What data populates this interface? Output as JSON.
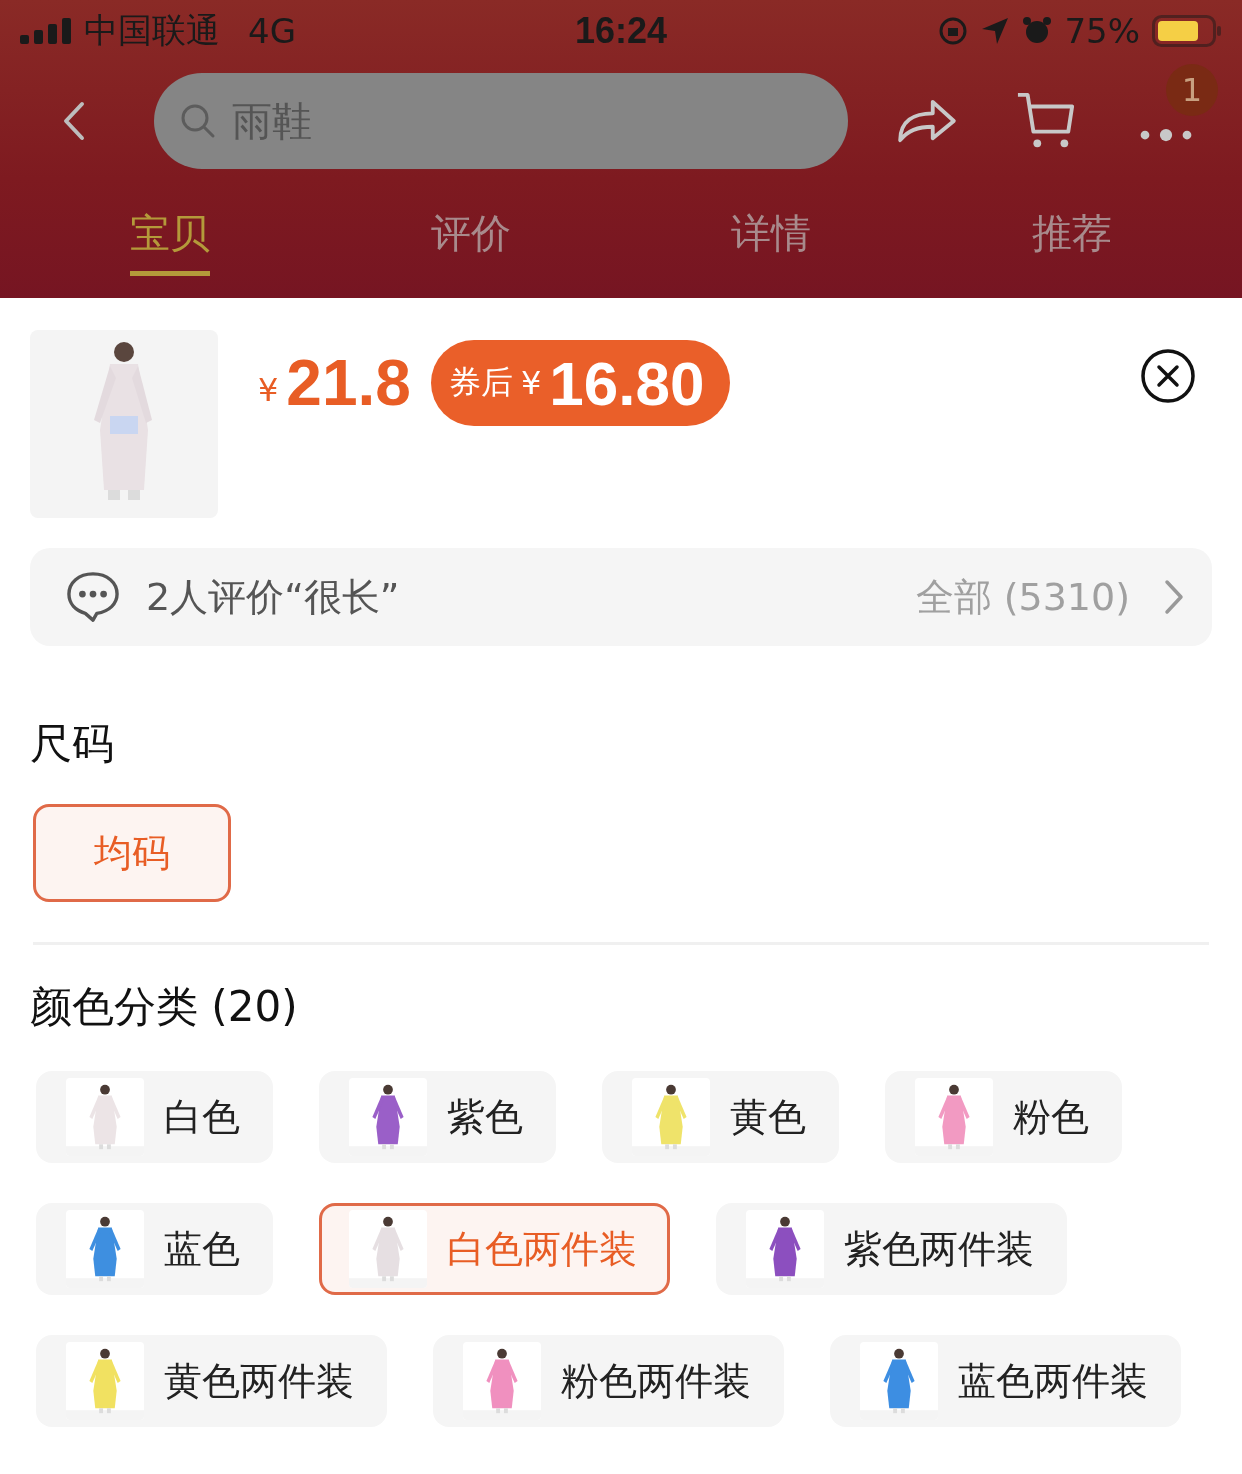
{
  "status_bar": {
    "carrier": "中国联通",
    "network": "4G",
    "time": "16:24",
    "battery": "75%"
  },
  "nav": {
    "search_value": "雨鞋",
    "badge": "1"
  },
  "tabs": [
    {
      "label": "宝贝",
      "selected": true
    },
    {
      "label": "评价",
      "selected": false
    },
    {
      "label": "详情",
      "selected": false
    },
    {
      "label": "推荐",
      "selected": false
    }
  ],
  "product": {
    "currency": "¥",
    "price": "21.8",
    "coupon_label": "券后",
    "coupon_currency": "¥",
    "coupon_price": "16.80"
  },
  "review_bar": {
    "text": "2人评价“很长”",
    "all": "全部 (5310)"
  },
  "size": {
    "title": "尺码",
    "options": [
      {
        "label": "均码",
        "selected": true
      }
    ]
  },
  "colors": {
    "title": "颜色分类 (20)",
    "options": [
      {
        "label": "白色",
        "selected": false,
        "color": "#ece4e6"
      },
      {
        "label": "紫色",
        "selected": false,
        "color": "#9a5fc8"
      },
      {
        "label": "黄色",
        "selected": false,
        "color": "#efe36a"
      },
      {
        "label": "粉色",
        "selected": false,
        "color": "#f29ac2"
      },
      {
        "label": "蓝色",
        "selected": false,
        "color": "#3e8fe0"
      },
      {
        "label": "白色两件装",
        "selected": true,
        "color": "#e6dfe2"
      },
      {
        "label": "紫色两件装",
        "selected": false,
        "color": "#8c4fbf"
      },
      {
        "label": "黄色两件装",
        "selected": false,
        "color": "#f1e161"
      },
      {
        "label": "粉色两件装",
        "selected": false,
        "color": "#f090bf"
      },
      {
        "label": "蓝色两件装",
        "selected": false,
        "color": "#3d8ee2"
      }
    ]
  }
}
